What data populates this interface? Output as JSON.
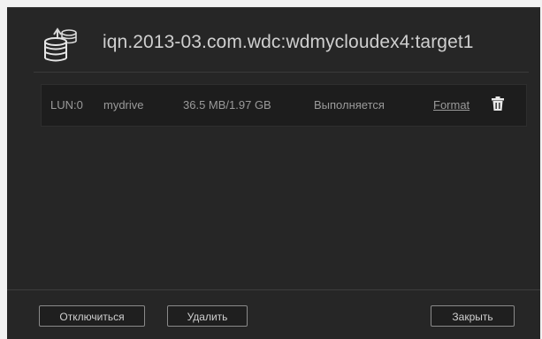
{
  "dialog": {
    "title": "iqn.2013-03.com.wdc:wdmycloudex4:target1",
    "title_icon": "database-share-icon"
  },
  "luns": [
    {
      "lun": "LUN:0",
      "name": "mydrive",
      "size": "36.5 MB/1.97 GB",
      "status": "Выполняется",
      "format_label": "Format",
      "delete_icon": "trash-icon"
    }
  ],
  "footer": {
    "disconnect_label": "Отключиться",
    "delete_label": "Удалить",
    "close_label": "Закрыть"
  }
}
